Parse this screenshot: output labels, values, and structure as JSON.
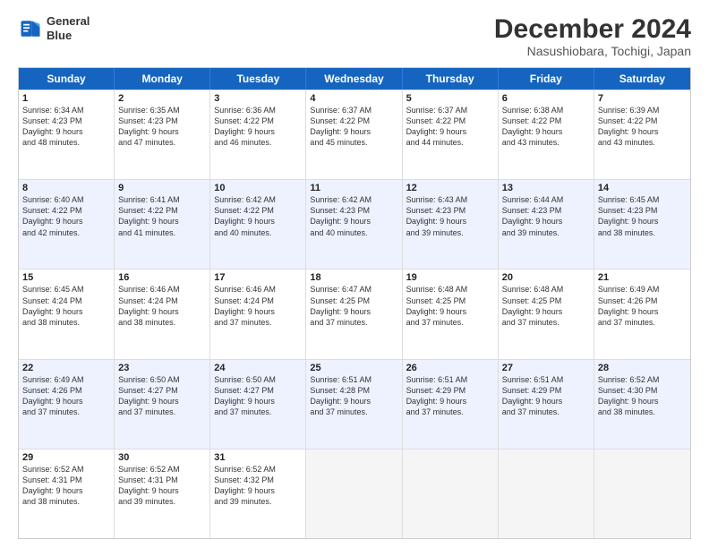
{
  "header": {
    "logo_line1": "General",
    "logo_line2": "Blue",
    "title": "December 2024",
    "subtitle": "Nasushiobara, Tochigi, Japan"
  },
  "days": [
    "Sunday",
    "Monday",
    "Tuesday",
    "Wednesday",
    "Thursday",
    "Friday",
    "Saturday"
  ],
  "weeks": [
    [
      {
        "day": "1",
        "lines": [
          "Sunrise: 6:34 AM",
          "Sunset: 4:23 PM",
          "Daylight: 9 hours",
          "and 48 minutes."
        ]
      },
      {
        "day": "2",
        "lines": [
          "Sunrise: 6:35 AM",
          "Sunset: 4:23 PM",
          "Daylight: 9 hours",
          "and 47 minutes."
        ]
      },
      {
        "day": "3",
        "lines": [
          "Sunrise: 6:36 AM",
          "Sunset: 4:22 PM",
          "Daylight: 9 hours",
          "and 46 minutes."
        ]
      },
      {
        "day": "4",
        "lines": [
          "Sunrise: 6:37 AM",
          "Sunset: 4:22 PM",
          "Daylight: 9 hours",
          "and 45 minutes."
        ]
      },
      {
        "day": "5",
        "lines": [
          "Sunrise: 6:37 AM",
          "Sunset: 4:22 PM",
          "Daylight: 9 hours",
          "and 44 minutes."
        ]
      },
      {
        "day": "6",
        "lines": [
          "Sunrise: 6:38 AM",
          "Sunset: 4:22 PM",
          "Daylight: 9 hours",
          "and 43 minutes."
        ]
      },
      {
        "day": "7",
        "lines": [
          "Sunrise: 6:39 AM",
          "Sunset: 4:22 PM",
          "Daylight: 9 hours",
          "and 43 minutes."
        ]
      }
    ],
    [
      {
        "day": "8",
        "lines": [
          "Sunrise: 6:40 AM",
          "Sunset: 4:22 PM",
          "Daylight: 9 hours",
          "and 42 minutes."
        ]
      },
      {
        "day": "9",
        "lines": [
          "Sunrise: 6:41 AM",
          "Sunset: 4:22 PM",
          "Daylight: 9 hours",
          "and 41 minutes."
        ]
      },
      {
        "day": "10",
        "lines": [
          "Sunrise: 6:42 AM",
          "Sunset: 4:22 PM",
          "Daylight: 9 hours",
          "and 40 minutes."
        ]
      },
      {
        "day": "11",
        "lines": [
          "Sunrise: 6:42 AM",
          "Sunset: 4:23 PM",
          "Daylight: 9 hours",
          "and 40 minutes."
        ]
      },
      {
        "day": "12",
        "lines": [
          "Sunrise: 6:43 AM",
          "Sunset: 4:23 PM",
          "Daylight: 9 hours",
          "and 39 minutes."
        ]
      },
      {
        "day": "13",
        "lines": [
          "Sunrise: 6:44 AM",
          "Sunset: 4:23 PM",
          "Daylight: 9 hours",
          "and 39 minutes."
        ]
      },
      {
        "day": "14",
        "lines": [
          "Sunrise: 6:45 AM",
          "Sunset: 4:23 PM",
          "Daylight: 9 hours",
          "and 38 minutes."
        ]
      }
    ],
    [
      {
        "day": "15",
        "lines": [
          "Sunrise: 6:45 AM",
          "Sunset: 4:24 PM",
          "Daylight: 9 hours",
          "and 38 minutes."
        ]
      },
      {
        "day": "16",
        "lines": [
          "Sunrise: 6:46 AM",
          "Sunset: 4:24 PM",
          "Daylight: 9 hours",
          "and 38 minutes."
        ]
      },
      {
        "day": "17",
        "lines": [
          "Sunrise: 6:46 AM",
          "Sunset: 4:24 PM",
          "Daylight: 9 hours",
          "and 37 minutes."
        ]
      },
      {
        "day": "18",
        "lines": [
          "Sunrise: 6:47 AM",
          "Sunset: 4:25 PM",
          "Daylight: 9 hours",
          "and 37 minutes."
        ]
      },
      {
        "day": "19",
        "lines": [
          "Sunrise: 6:48 AM",
          "Sunset: 4:25 PM",
          "Daylight: 9 hours",
          "and 37 minutes."
        ]
      },
      {
        "day": "20",
        "lines": [
          "Sunrise: 6:48 AM",
          "Sunset: 4:25 PM",
          "Daylight: 9 hours",
          "and 37 minutes."
        ]
      },
      {
        "day": "21",
        "lines": [
          "Sunrise: 6:49 AM",
          "Sunset: 4:26 PM",
          "Daylight: 9 hours",
          "and 37 minutes."
        ]
      }
    ],
    [
      {
        "day": "22",
        "lines": [
          "Sunrise: 6:49 AM",
          "Sunset: 4:26 PM",
          "Daylight: 9 hours",
          "and 37 minutes."
        ]
      },
      {
        "day": "23",
        "lines": [
          "Sunrise: 6:50 AM",
          "Sunset: 4:27 PM",
          "Daylight: 9 hours",
          "and 37 minutes."
        ]
      },
      {
        "day": "24",
        "lines": [
          "Sunrise: 6:50 AM",
          "Sunset: 4:27 PM",
          "Daylight: 9 hours",
          "and 37 minutes."
        ]
      },
      {
        "day": "25",
        "lines": [
          "Sunrise: 6:51 AM",
          "Sunset: 4:28 PM",
          "Daylight: 9 hours",
          "and 37 minutes."
        ]
      },
      {
        "day": "26",
        "lines": [
          "Sunrise: 6:51 AM",
          "Sunset: 4:29 PM",
          "Daylight: 9 hours",
          "and 37 minutes."
        ]
      },
      {
        "day": "27",
        "lines": [
          "Sunrise: 6:51 AM",
          "Sunset: 4:29 PM",
          "Daylight: 9 hours",
          "and 37 minutes."
        ]
      },
      {
        "day": "28",
        "lines": [
          "Sunrise: 6:52 AM",
          "Sunset: 4:30 PM",
          "Daylight: 9 hours",
          "and 38 minutes."
        ]
      }
    ],
    [
      {
        "day": "29",
        "lines": [
          "Sunrise: 6:52 AM",
          "Sunset: 4:31 PM",
          "Daylight: 9 hours",
          "and 38 minutes."
        ]
      },
      {
        "day": "30",
        "lines": [
          "Sunrise: 6:52 AM",
          "Sunset: 4:31 PM",
          "Daylight: 9 hours",
          "and 39 minutes."
        ]
      },
      {
        "day": "31",
        "lines": [
          "Sunrise: 6:52 AM",
          "Sunset: 4:32 PM",
          "Daylight: 9 hours",
          "and 39 minutes."
        ]
      },
      null,
      null,
      null,
      null
    ]
  ]
}
